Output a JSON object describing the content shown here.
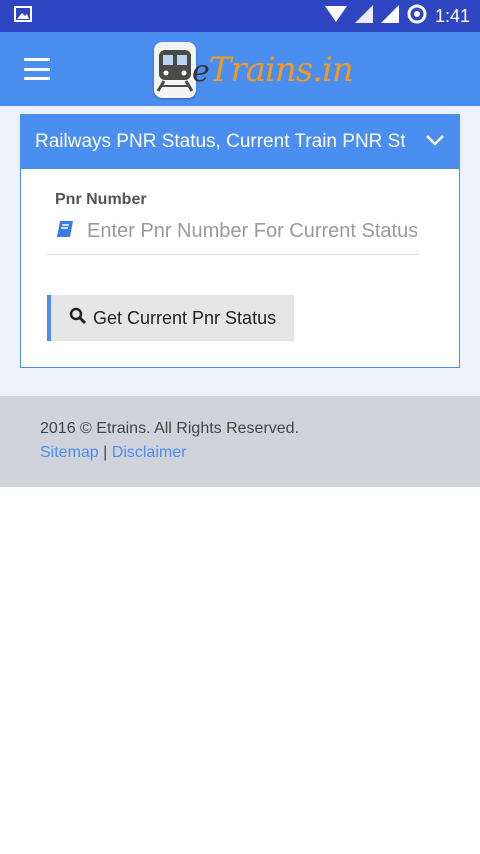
{
  "statusbar": {
    "time": "1:41"
  },
  "header": {
    "logo_e": "e",
    "logo_rest": "Trains.in"
  },
  "card": {
    "title": "Railways PNR Status, Current Train PNR Status",
    "pnr_label": "Pnr Number",
    "pnr_placeholder": "Enter Pnr Number For Current Status",
    "pnr_value": "",
    "button_label": "Get Current Pnr Status"
  },
  "footer": {
    "copyright": "2016 © Etrains. All Rights Reserved.",
    "sitemap": "Sitemap",
    "separator": "|",
    "disclaimer": "Disclaimer"
  },
  "colors": {
    "statusbar": "#2e46c2",
    "primary": "#4a8ef0",
    "logo_orange": "#f39a1e"
  }
}
